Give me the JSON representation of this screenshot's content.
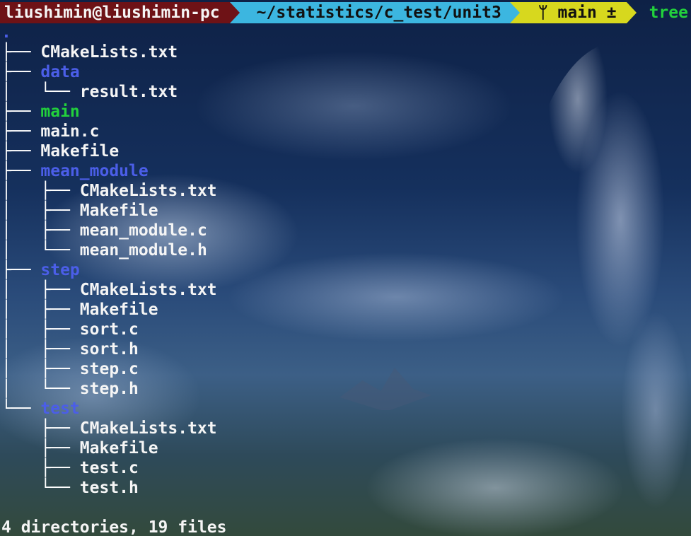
{
  "prompt": {
    "user_host": "liushimin@liushimin-pc",
    "path": "~/statistics/c_test/unit3",
    "git_branch": "ᛘ main ±",
    "command": "tree"
  },
  "tree": {
    "root": ".",
    "entries": [
      {
        "prefix": "├── ",
        "name": "CMakeLists.txt",
        "kind": "file"
      },
      {
        "prefix": "├── ",
        "name": "data",
        "kind": "dir"
      },
      {
        "prefix": "│   └── ",
        "name": "result.txt",
        "kind": "file"
      },
      {
        "prefix": "├── ",
        "name": "main",
        "kind": "exe"
      },
      {
        "prefix": "├── ",
        "name": "main.c",
        "kind": "file"
      },
      {
        "prefix": "├── ",
        "name": "Makefile",
        "kind": "file"
      },
      {
        "prefix": "├── ",
        "name": "mean_module",
        "kind": "dir"
      },
      {
        "prefix": "│   ├── ",
        "name": "CMakeLists.txt",
        "kind": "file"
      },
      {
        "prefix": "│   ├── ",
        "name": "Makefile",
        "kind": "file"
      },
      {
        "prefix": "│   ├── ",
        "name": "mean_module.c",
        "kind": "file"
      },
      {
        "prefix": "│   └── ",
        "name": "mean_module.h",
        "kind": "file"
      },
      {
        "prefix": "├── ",
        "name": "step",
        "kind": "dir"
      },
      {
        "prefix": "│   ├── ",
        "name": "CMakeLists.txt",
        "kind": "file"
      },
      {
        "prefix": "│   ├── ",
        "name": "Makefile",
        "kind": "file"
      },
      {
        "prefix": "│   ├── ",
        "name": "sort.c",
        "kind": "file"
      },
      {
        "prefix": "│   ├── ",
        "name": "sort.h",
        "kind": "file"
      },
      {
        "prefix": "│   ├── ",
        "name": "step.c",
        "kind": "file"
      },
      {
        "prefix": "│   └── ",
        "name": "step.h",
        "kind": "file"
      },
      {
        "prefix": "└── ",
        "name": "test",
        "kind": "dir"
      },
      {
        "prefix": "    ├── ",
        "name": "CMakeLists.txt",
        "kind": "file"
      },
      {
        "prefix": "    ├── ",
        "name": "Makefile",
        "kind": "file"
      },
      {
        "prefix": "    ├── ",
        "name": "test.c",
        "kind": "file"
      },
      {
        "prefix": "    └── ",
        "name": "test.h",
        "kind": "file"
      }
    ]
  },
  "summary": "4 directories, 19 files",
  "colors": {
    "directory": "#4b5ee8",
    "executable": "#22d13c",
    "file": "#f5f5f5",
    "segment_user": "#6e1216",
    "segment_path": "#3cb6e0",
    "segment_git": "#d7d81e"
  }
}
